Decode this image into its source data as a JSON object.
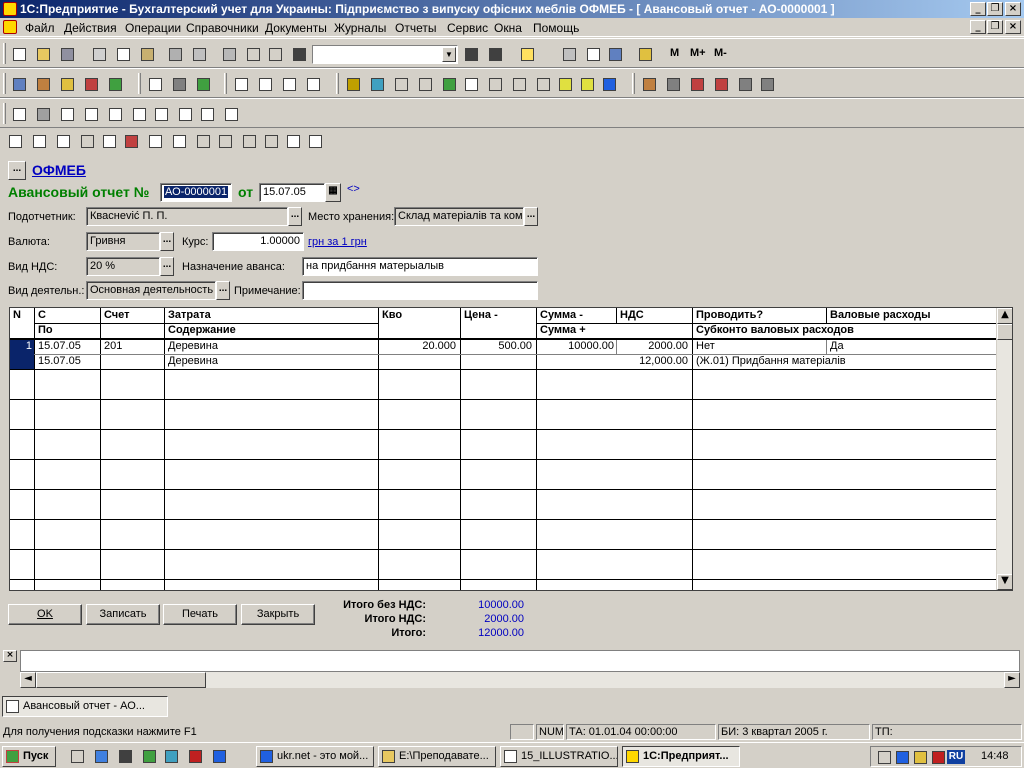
{
  "window": {
    "title": "1С:Предприятие - Бухгалтерский учет для Украины: Підприємство з випуску офісних меблів ОФМЕБ - [ Авансовый отчет - АО-0000001 ]"
  },
  "menu": [
    "Файл",
    "Действия",
    "Операции",
    "Справочники",
    "Документы",
    "Журналы",
    "Отчеты",
    "Сервис",
    "Окна",
    "Помощь"
  ],
  "toolbar": {
    "search_value": "",
    "memory_buttons": [
      "M",
      "M+",
      "M-"
    ]
  },
  "form": {
    "org_link": "ОФМЕБ",
    "org_btn": "...",
    "doc_title": "Авансовый отчет №",
    "doc_number": "АО-0000001",
    "date_label": "от",
    "doc_date": "15.07.05",
    "arrow": "<>",
    "labels": {
      "accountable": "Подотчетник:",
      "storage": "Место хранения:",
      "currency": "Валюта:",
      "rate": "Курс:",
      "vat_type": "Вид НДС:",
      "purpose": "Назначение аванса:",
      "activity": "Вид деятельн.:",
      "note": "Примечание:"
    },
    "values": {
      "accountable": "Кваснević П. П.",
      "storage": "Склад матеріалів та ком",
      "currency": "Гривня",
      "rate": "1.00000",
      "rate_unit": "грн за 1 грн",
      "vat_type": "20 %",
      "purpose": "на придбання матерыалыв",
      "activity": "Основная деятельность",
      "note": ""
    }
  },
  "grid": {
    "headers_top": [
      "N",
      "С",
      "Счет",
      "Затрата",
      "Кво",
      "Цена -",
      "Сумма -",
      "НДС",
      "Проводить?",
      "Валовые расходы"
    ],
    "headers_bottom": [
      "По",
      "Содержание",
      "Сумма +",
      "Субконто валовых расходов"
    ],
    "rows": [
      {
        "n": "1",
        "from": "15.07.05",
        "account": "201",
        "cost": "Деревина",
        "qty": "20.000",
        "price": "500.00",
        "sum_minus": "10000.00",
        "vat": "2000.00",
        "post": "Нет",
        "gross": "Да",
        "to": "15.07.05",
        "content": "Деревина",
        "sum_plus": "12,000.00",
        "subconto": "(Ж.01) Придбання матеріалів"
      }
    ]
  },
  "buttons": {
    "ok": "OK",
    "save": "Записать",
    "print": "Печать",
    "close": "Закрыть"
  },
  "totals": {
    "no_vat_label": "Итого без НДС:",
    "no_vat": "10000.00",
    "vat_label": "Итого НДС:",
    "vat": "2000.00",
    "total_label": "Итого:",
    "total": "12000.00"
  },
  "docbar": {
    "tab": "Авансовый отчет - АО..."
  },
  "status": {
    "hint": "Для получения подсказки нажмите F1",
    "num": "NUM",
    "ta": "ТА: 01.01.04  00:00:00",
    "bi": "БИ: 3 квартал 2005 г.",
    "tp": "ТП:"
  },
  "taskbar": {
    "start": "Пуск",
    "tasks": [
      "ukr.net - это мой...",
      "E:\\Преподавате...",
      "15_ILLUSTRATIO...",
      "1С:Предприят..."
    ],
    "lang": "RU",
    "clock": "14:48"
  }
}
